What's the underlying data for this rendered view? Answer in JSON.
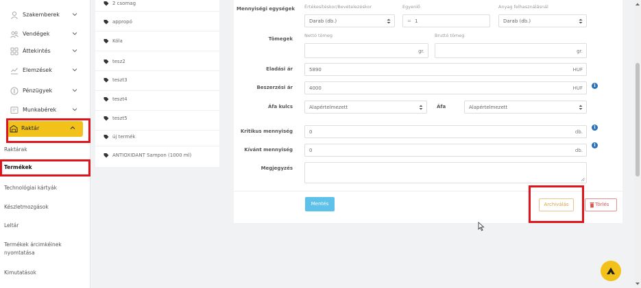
{
  "sidebar": {
    "items": [
      {
        "label": "Szakemberek",
        "icon": "person-icon"
      },
      {
        "label": "Vendégek",
        "icon": "users-icon"
      },
      {
        "label": "Áttekintés",
        "icon": "grid-icon"
      },
      {
        "label": "Elemzések",
        "icon": "chart-icon"
      },
      {
        "label": "Pénzügyek",
        "icon": "money-icon"
      },
      {
        "label": "Munkabérek",
        "icon": "payslip-icon"
      }
    ],
    "active": {
      "label": "Raktár",
      "icon": "warehouse-icon"
    },
    "subitems": [
      "Raktárak",
      "Termékek",
      "Technológiai kártyák",
      "Készletmozgások",
      "Leltár",
      "Termékek árcimkéinek nyomtatása",
      "Kimutatások"
    ],
    "active_subitem": "Termékek"
  },
  "products": [
    "2 csomag",
    "appropó",
    "Kóla",
    "tesz2",
    "teszt3",
    "teszt4",
    "teszt5",
    "új termék",
    "ANTIOXIDANT Sampon (1000 ml)"
  ],
  "form": {
    "units_label": "Mennyiségi egységek",
    "sales_unit_label": "Értékesítéskor/Bevételezéskor",
    "sales_unit_value": "Darab (db.)",
    "equals_label": "Egyenlő",
    "equals_sign": "=",
    "equals_value": "1",
    "material_unit_label": "Anyag felhasználásnál",
    "material_unit_value": "Darab (db.)",
    "weights_label": "Tömegek",
    "net_label": "Nettó tömeg",
    "gross_label": "Bruttó tömeg",
    "weight_unit": "gr.",
    "sale_price_label": "Eladási ár",
    "sale_price_value": "5890",
    "purchase_price_label": "Beszerzési ár",
    "purchase_price_value": "4000",
    "currency": "HUF",
    "vat_key_label": "Áfa kulcs",
    "vat_key_value": "Alapértelmezett",
    "vat_label": "Áfa",
    "vat_value": "Alapértelmezett",
    "critical_label": "Kritikus mennyiség",
    "critical_value": "0",
    "desired_label": "Kívánt mennyiség",
    "desired_value": "0",
    "qty_unit": "db.",
    "note_label": "Megjegyzés",
    "info_symbol": "i"
  },
  "buttons": {
    "save": "Mentés",
    "archive": "Archiválás",
    "delete": "Törlés"
  },
  "colors": {
    "accent": "#f3c21a",
    "save": "#5dc1ea",
    "highlight": "#e0131a",
    "info": "#2a72b9"
  }
}
